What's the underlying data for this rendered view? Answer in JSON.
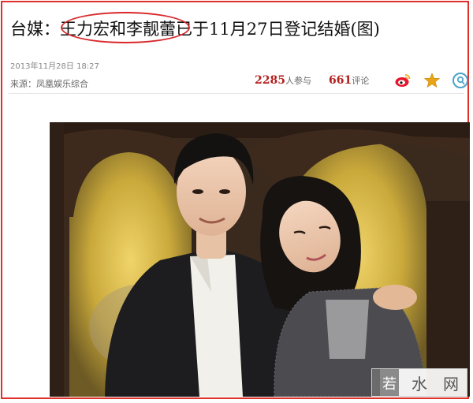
{
  "article": {
    "title": "台媒：王力宏和李靓蕾已于11月27日登记结婚(图)",
    "date": "2013年11月28日 18:27",
    "source": "来源：凤凰娱乐综合",
    "participants_count": "2285",
    "participants_label": "人参与",
    "comments_count": "661",
    "comments_label": "评论"
  },
  "share_icons": [
    "weibo-icon",
    "favorite-star-icon",
    "share-icon"
  ],
  "watermark": {
    "text": "若水网"
  },
  "colors": {
    "highlight_border": "#e0302a",
    "count_red": "#b3201e",
    "star_gold": "#e8a317"
  }
}
